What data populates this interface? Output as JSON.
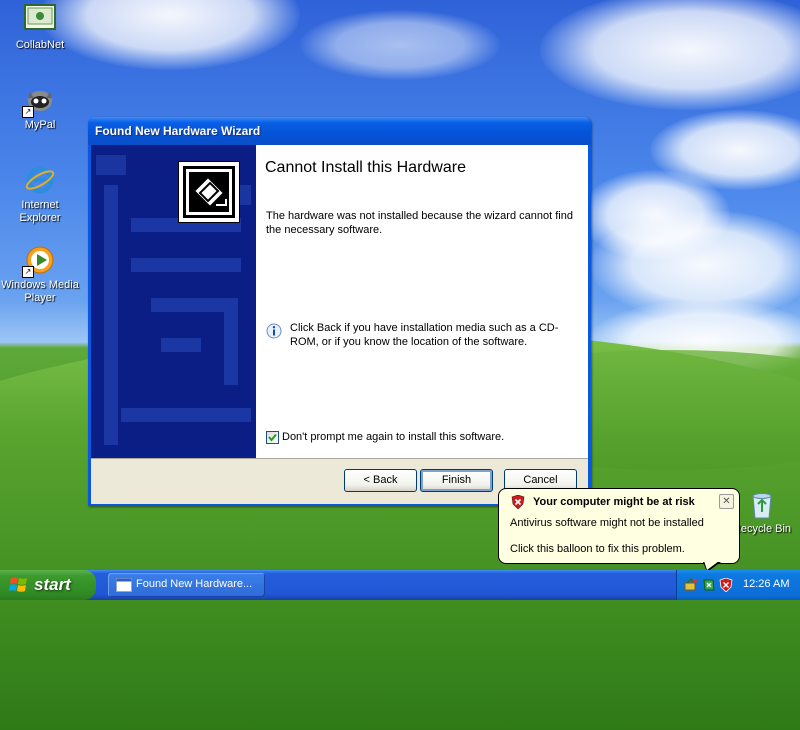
{
  "desktop": {
    "icons": [
      {
        "label": "CollabNet"
      },
      {
        "label": "MyPal"
      },
      {
        "label": "Internet Explorer"
      },
      {
        "label": "Windows Media Player"
      },
      {
        "label": "Recycle Bin"
      }
    ]
  },
  "wizard": {
    "title": "Found New Hardware Wizard",
    "heading": "Cannot Install this Hardware",
    "message": "The hardware was not installed because the wizard cannot find the necessary software.",
    "info": "Click Back if you have installation media such as a CD-ROM, or if you know the location of the software.",
    "checkbox_label": "Don't prompt me again to install this software.",
    "checkbox_checked": true,
    "buttons": {
      "back": "< Back",
      "finish": "Finish",
      "cancel": "Cancel"
    }
  },
  "taskbar": {
    "start_label": "start",
    "task_label": "Found New Hardware...",
    "clock": "12:26 AM"
  },
  "balloon": {
    "title": "Your computer might be at risk",
    "line1": "Antivirus software might not be installed",
    "line2": "Click this balloon to fix this problem."
  }
}
